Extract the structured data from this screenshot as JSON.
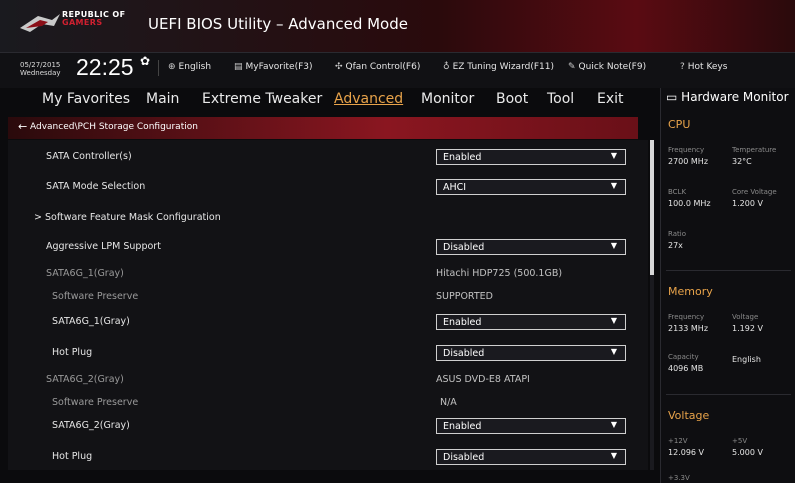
{
  "header": {
    "brand_line1": "REPUBLIC OF",
    "brand_line2": "GAMERS",
    "title": "UEFI BIOS Utility – Advanced Mode"
  },
  "infobar": {
    "date": "05/27/2015",
    "day": "Wednesday",
    "time": "22:25",
    "tools": [
      {
        "icon": "globe-icon",
        "label": "English"
      },
      {
        "icon": "favorite-icon",
        "label": "MyFavorite(F3)"
      },
      {
        "icon": "fan-icon",
        "label": "Qfan Control(F6)"
      },
      {
        "icon": "bulb-icon",
        "label": "EZ Tuning Wizard(F11)"
      },
      {
        "icon": "note-icon",
        "label": "Quick Note(F9)"
      },
      {
        "icon": "help-icon",
        "label": "Hot Keys"
      }
    ]
  },
  "menu": {
    "items": [
      {
        "label": "My Favorites"
      },
      {
        "label": "Main"
      },
      {
        "label": "Extreme Tweaker"
      },
      {
        "label": "Advanced",
        "active": true
      },
      {
        "label": "Monitor"
      },
      {
        "label": "Boot"
      },
      {
        "label": "Tool"
      },
      {
        "label": "Exit"
      }
    ]
  },
  "breadcrumb": {
    "text": "Advanced\\PCH Storage Configuration"
  },
  "settings": {
    "sata_controller": {
      "label": "SATA Controller(s)",
      "value": "Enabled"
    },
    "sata_mode": {
      "label": "SATA Mode Selection",
      "value": "AHCI"
    },
    "feature_mask": {
      "label": "Software Feature Mask Configuration"
    },
    "aggressive_lpm": {
      "label": "Aggressive LPM Support",
      "value": "Disabled"
    },
    "sata6g1_header": {
      "label": "SATA6G_1(Gray)",
      "value": "Hitachi HDP725 (500.1GB)"
    },
    "sata6g1_sw": {
      "label": "Software Preserve",
      "value": "SUPPORTED"
    },
    "sata6g1_port": {
      "label": "SATA6G_1(Gray)",
      "value": "Enabled"
    },
    "sata6g1_hotplug": {
      "label": "Hot Plug",
      "value": "Disabled"
    },
    "sata6g2_header": {
      "label": "SATA6G_2(Gray)",
      "value": "ASUS   DVD-E8 ATAPI"
    },
    "sata6g2_sw": {
      "label": "Software Preserve",
      "value": "N/A"
    },
    "sata6g2_port": {
      "label": "SATA6G_2(Gray)",
      "value": "Enabled"
    },
    "sata6g2_hotplug": {
      "label": "Hot Plug",
      "value": "Disabled"
    }
  },
  "hw_monitor": {
    "title": "Hardware Monitor",
    "cpu": {
      "section": "CPU",
      "frequency_label": "Frequency",
      "frequency": "2700 MHz",
      "temperature_label": "Temperature",
      "temperature": "32°C",
      "bclk_label": "BCLK",
      "bclk": "100.0 MHz",
      "core_voltage_label": "Core Voltage",
      "core_voltage": "1.200 V",
      "ratio_label": "Ratio",
      "ratio": "27x"
    },
    "memory": {
      "section": "Memory",
      "frequency_label": "Frequency",
      "frequency": "2133 MHz",
      "voltage_label": "Voltage",
      "voltage": "1.192 V",
      "capacity_label": "Capacity",
      "capacity": "4096 MB",
      "extra": "English"
    },
    "voltage": {
      "section": "Voltage",
      "v12_label": "+12V",
      "v12": "12.096 V",
      "v5_label": "+5V",
      "v5": "5.000 V",
      "v33_label": "+3.3V"
    }
  },
  "colors": {
    "accent": "#e8a34a",
    "breadcrumb": "#8a1620",
    "panel": "#0e0e11"
  }
}
